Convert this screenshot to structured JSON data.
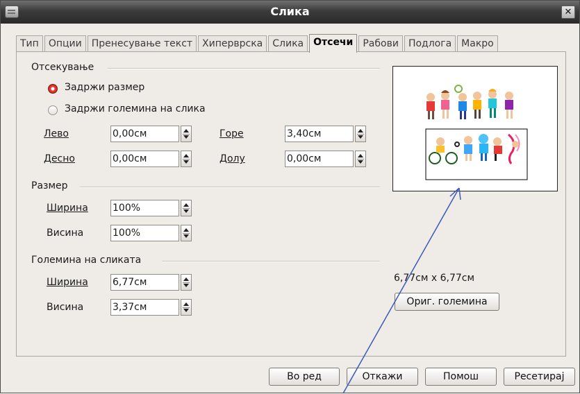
{
  "window": {
    "title": "Слика"
  },
  "tabs": [
    {
      "label": "Тип"
    },
    {
      "label": "Опции"
    },
    {
      "label": "Пренесување текст"
    },
    {
      "label": "Хиперврска"
    },
    {
      "label": "Слика"
    },
    {
      "label": "Отсечи",
      "active": true
    },
    {
      "label": "Рабови"
    },
    {
      "label": "Подлога"
    },
    {
      "label": "Макро"
    }
  ],
  "crop": {
    "section_label": "Отсекување",
    "keep_scale": "Задржи размер",
    "keep_scale_selected": true,
    "keep_size": "Задржи големина на слика",
    "left_label": "Лево",
    "left_value": "0,00см",
    "right_label": "Десно",
    "right_value": "0,00см",
    "top_label": "Горе",
    "top_value": "3,40см",
    "bottom_label": "Долу",
    "bottom_value": "0,00см"
  },
  "scale": {
    "section_label": "Размер",
    "width_label": "Ширина",
    "width_value": "100%",
    "height_label": "Висина",
    "height_value": "100%"
  },
  "image_size": {
    "section_label": "Големина на сликата",
    "width_label": "Ширина",
    "width_value": "6,77см",
    "height_label": "Висина",
    "height_value": "3,37см"
  },
  "original": {
    "size_text": "6,77см x 6,77см",
    "button_label": "Ориг. големина"
  },
  "buttons": {
    "ok": "Во ред",
    "cancel": "Откажи",
    "help": "Помош",
    "reset": "Ресетирај"
  },
  "colors": {
    "radio_selected": "#e03a32",
    "arrow": "#3a5bb8",
    "titlebar": "#3b3b3b"
  }
}
